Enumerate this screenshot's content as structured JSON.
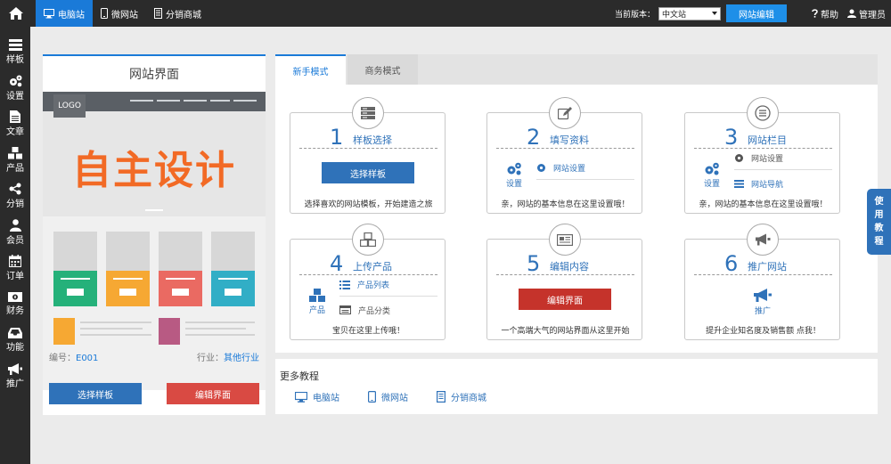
{
  "topbar": {
    "nav": [
      {
        "label": "电脑站",
        "icon": "desktop-icon",
        "active": true
      },
      {
        "label": "微网站",
        "icon": "mobile-icon",
        "active": false
      },
      {
        "label": "分销商城",
        "icon": "store-icon",
        "active": false
      }
    ],
    "version_label": "当前版本：",
    "version_value": "中文站",
    "site_edit": "网站编辑",
    "help": "帮助",
    "admin": "管理员"
  },
  "sidebar": {
    "items": [
      {
        "label": "样板",
        "icon": "template-icon"
      },
      {
        "label": "设置",
        "icon": "gears-icon"
      },
      {
        "label": "文章",
        "icon": "article-icon"
      },
      {
        "label": "产品",
        "icon": "product-icon"
      },
      {
        "label": "分销",
        "icon": "share-icon"
      },
      {
        "label": "会员",
        "icon": "user-icon"
      },
      {
        "label": "订单",
        "icon": "calendar-icon"
      },
      {
        "label": "财务",
        "icon": "money-icon"
      },
      {
        "label": "功能",
        "icon": "inbox-icon"
      },
      {
        "label": "推广",
        "icon": "megaphone-icon"
      }
    ]
  },
  "preview": {
    "title": "网站界面",
    "logo": "LOGO",
    "slogan": "自主设计",
    "code_label": "编号：",
    "code_value": "E001",
    "industry_label": "行业：",
    "industry_value": "其他行业",
    "choose_btn": "选择样板",
    "edit_btn": "编辑界面"
  },
  "tabs": [
    "新手模式",
    "商务模式"
  ],
  "steps": [
    {
      "num": "1",
      "title": "样板选择",
      "button": "选择样板",
      "footer": "选择喜欢的网站模板，开始建造之旅"
    },
    {
      "num": "2",
      "title": "填写资料",
      "left_label": "设置",
      "items": [
        "网站设置"
      ],
      "footer": "亲，网站的基本信息在这里设置哦！"
    },
    {
      "num": "3",
      "title": "网站栏目",
      "left_label": "设置",
      "items": [
        "网站设置",
        "网站导航"
      ],
      "footer": "亲，网站的基本信息在这里设置哦！"
    },
    {
      "num": "4",
      "title": "上传产品",
      "left_label": "产品",
      "items": [
        "产品列表",
        "产品分类"
      ],
      "footer": "宝贝在这里上传哦！"
    },
    {
      "num": "5",
      "title": "编辑内容",
      "button": "编辑界面",
      "footer": "一个高端大气的网站界面从这里开始"
    },
    {
      "num": "6",
      "title": "推广网站",
      "left_label": "推广",
      "footer": "提升企业知名度及销售额 点我！"
    }
  ],
  "more": {
    "title": "更多教程",
    "links": [
      {
        "label": "电脑站",
        "icon": "desktop-icon"
      },
      {
        "label": "微网站",
        "icon": "mobile-icon"
      },
      {
        "label": "分销商城",
        "icon": "store-icon"
      }
    ]
  },
  "tutorial_tab": {
    "chars": [
      "使",
      "用",
      "教",
      "程"
    ]
  },
  "colors": {
    "accent": "#1a7ad8",
    "primary": "#2f72b9",
    "danger": "#d94a43",
    "dark": "#2b2b2b",
    "slogan": "#f26a25"
  }
}
